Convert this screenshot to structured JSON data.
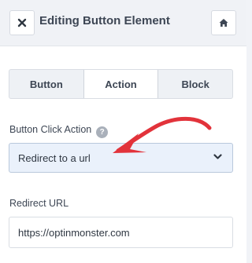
{
  "header": {
    "title": "Editing Button Element",
    "close_icon": "close-icon",
    "home_icon": "home-icon"
  },
  "tabs": [
    {
      "label": "Button",
      "active": false
    },
    {
      "label": "Action",
      "active": true
    },
    {
      "label": "Block",
      "active": false
    }
  ],
  "click_action": {
    "label": "Button Click Action",
    "help": "?",
    "value": "Redirect to a url"
  },
  "redirect": {
    "label": "Redirect URL",
    "value": "https://optinmonster.com"
  },
  "colors": {
    "accent": "#e2333b",
    "select_bg": "#eaf1fb"
  }
}
